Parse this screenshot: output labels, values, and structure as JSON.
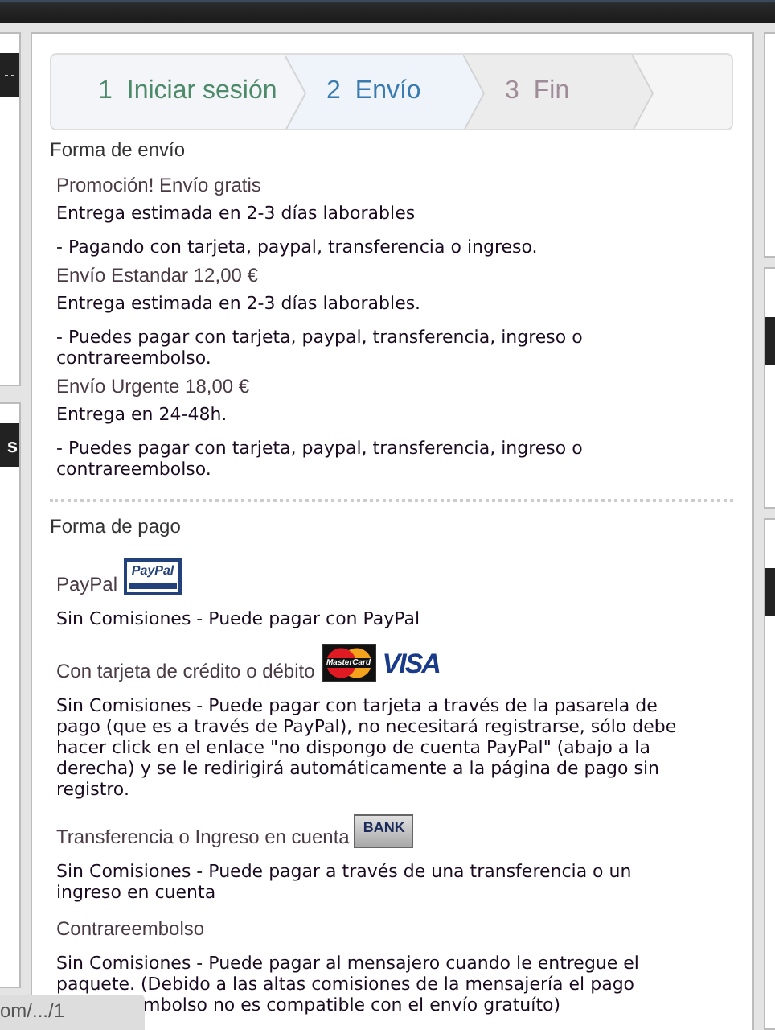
{
  "left_panel": {
    "tab_label": "s"
  },
  "steps": [
    {
      "number": "1",
      "label": "Iniciar sesión",
      "done": true,
      "selected": false
    },
    {
      "number": "2",
      "label": "Envío",
      "done": false,
      "selected": true
    },
    {
      "number": "3",
      "label": "Fin",
      "done": false,
      "selected": false
    }
  ],
  "shipping": {
    "heading": "Forma de envío",
    "options": [
      {
        "title": "Promoción! Envío gratis",
        "delivery": "Entrega estimada en 2-3 días laborables",
        "note": "- Pagando con tarjeta, paypal, transferencia o ingreso."
      },
      {
        "title": "Envío Estandar 12,00 €",
        "delivery": "Entrega estimada en 2-3 días laborables.",
        "note": "- Puedes pagar con tarjeta, paypal, transferencia, ingreso o contrareembolso."
      },
      {
        "title": "Envío Urgente 18,00 €",
        "delivery": "Entrega en 24-48h.",
        "note": "- Puedes pagar con tarjeta, paypal, transferencia, ingreso o contrareembolso."
      }
    ]
  },
  "payment": {
    "heading": "Forma de pago",
    "methods": [
      {
        "title": "PayPal",
        "logos": [
          {
            "kind": "paypal",
            "text": "PayPal"
          }
        ],
        "description": "Sin Comisiones - Puede pagar con PayPal"
      },
      {
        "title": "Con tarjeta de crédito o débito",
        "logos": [
          {
            "kind": "mastercard",
            "text": "MasterCard"
          },
          {
            "kind": "visa",
            "text": "VISA"
          }
        ],
        "description": "Sin Comisiones - Puede pagar con tarjeta a través de la pasarela de pago (que es a través de PayPal), no necesitará registrarse, sólo debe hacer click en el enlace \"no dispongo de cuenta PayPal\" (abajo a la derecha) y se le redirigirá automáticamente a la página de pago sin registro."
      },
      {
        "title": "Transferencia o Ingreso en cuenta",
        "logos": [
          {
            "kind": "bank",
            "text": "BANK"
          }
        ],
        "description": "Sin Comisiones - Puede pagar a través de una transferencia o un ingreso en cuenta"
      },
      {
        "title": "Contrareembolso",
        "description": "Sin Comisiones - Puede pagar al mensajero cuando le entregue el paquete. (Debido a las altas comisiones de la mensajería el pago",
        "description_tail": "mbolso no es compatible con el envío gratuíto)"
      }
    ]
  },
  "status_bar": {
    "url": "om/.../1"
  }
}
